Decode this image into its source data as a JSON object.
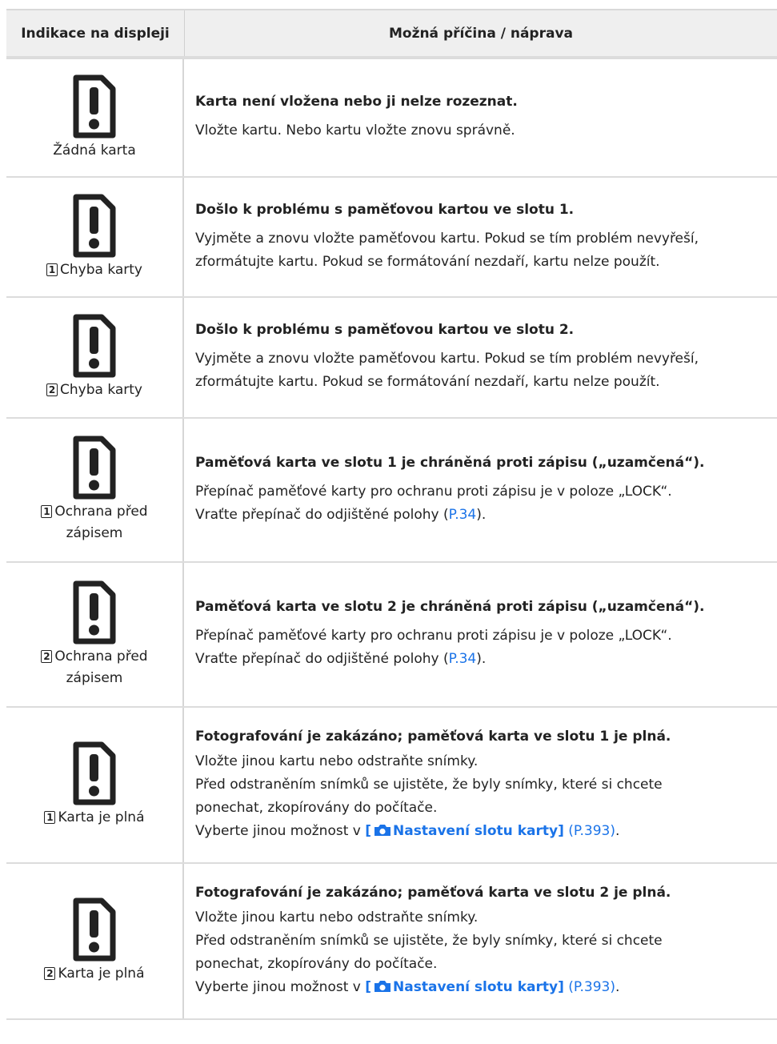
{
  "header": {
    "col1": "Indikace na displeji",
    "col2": "Možná příčina / náprava"
  },
  "rows": [
    {
      "slot": "",
      "label": "Žádná karta",
      "title": "Karta není vložena nebo ji nelze rozeznat.",
      "lines": [
        "Vložte kartu. Nebo kartu vložte znovu správně."
      ]
    },
    {
      "slot": "1",
      "label": "Chyba karty",
      "title": "Došlo k problému s paměťovou kartou ve slotu 1.",
      "lines": [
        "Vyjměte a znovu vložte paměťovou kartu. Pokud se tím problém nevyřeší,",
        "zformátujte kartu. Pokud se formátování nezdaří, kartu nelze použít."
      ]
    },
    {
      "slot": "2",
      "label": "Chyba karty",
      "title": "Došlo k problému s paměťovou kartou ve slotu 2.",
      "lines": [
        "Vyjměte a znovu vložte paměťovou kartu. Pokud se tím problém nevyřeší,",
        "zformátujte kartu. Pokud se formátování nezdaří, kartu nelze použít."
      ]
    },
    {
      "slot": "1",
      "label": "Ochrana před",
      "label2": "zápisem",
      "title": "Paměťová karta ve slotu 1 je chráněná proti zápisu („uzamčená“).",
      "lines": [
        "Přepínač paměťové karty pro ochranu proti zápisu je v poloze „LOCK“."
      ],
      "line_link_pre": "Vraťte přepínač do odjištěné polohy (",
      "line_link": "P.34",
      "line_link_post": ")."
    },
    {
      "slot": "2",
      "label": "Ochrana před",
      "label2": "zápisem",
      "title": "Paměťová karta ve slotu 2 je chráněná proti zápisu („uzamčená“).",
      "lines": [
        "Přepínač paměťové karty pro ochranu proti zápisu je v poloze „LOCK“."
      ],
      "line_link_pre": "Vraťte přepínač do odjištěné polohy (",
      "line_link": "P.34",
      "line_link_post": ")."
    },
    {
      "slot": "1",
      "label": "Karta je plná",
      "title": "Fotografování je zakázáno; paměťová karta ve slotu 1 je plná.",
      "lines": [
        "Vložte jinou kartu nebo odstraňte snímky.",
        "Před odstraněním snímků se ujistěte, že byly snímky, které si chcete",
        "ponechat, zkopírovány do počítače."
      ],
      "menu_pre": "Vyberte jinou možnost v ",
      "menu_open": "[",
      "menu_name": "Nastavení slotu karty]",
      "menu_ref": " (P.393)",
      "menu_post": "."
    },
    {
      "slot": "2",
      "label": "Karta je plná",
      "title": "Fotografování je zakázáno; paměťová karta ve slotu 2 je plná.",
      "lines": [
        "Vložte jinou kartu nebo odstraňte snímky.",
        "Před odstraněním snímků se ujistěte, že byly snímky, které si chcete",
        "ponechat, zkopírovány do počítače."
      ],
      "menu_pre": "Vyberte jinou možnost v ",
      "menu_open": "[",
      "menu_name": "Nastavení slotu karty]",
      "menu_ref": " (P.393)",
      "menu_post": "."
    }
  ]
}
